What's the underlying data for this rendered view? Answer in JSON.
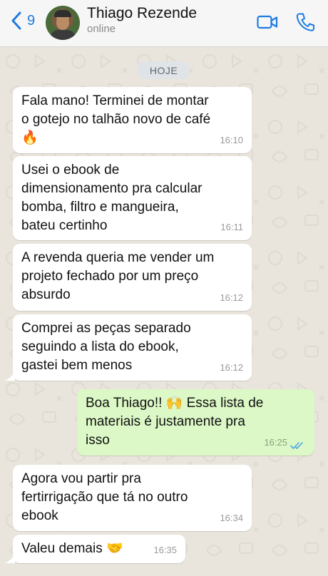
{
  "header": {
    "back_count": "9",
    "contact_name": "Thiago Rezende",
    "contact_status": "online",
    "icons": {
      "back": "chevron-left-icon",
      "video": "video-camera-icon",
      "call": "phone-icon"
    },
    "accent_color": "#1f7ae0"
  },
  "chat": {
    "date_label": "HOJE",
    "messages": [
      {
        "direction": "incoming",
        "lines": [
          "Fala mano! Terminei de montar",
          "o gotejo no talhão novo de café",
          "🔥"
        ],
        "time": "16:10"
      },
      {
        "direction": "incoming",
        "lines": [
          "Usei o ebook de",
          "dimensionamento pra calcular",
          "bomba, filtro e mangueira,",
          "bateu certinho"
        ],
        "time": "16:11"
      },
      {
        "direction": "incoming",
        "lines": [
          "A revenda queria me vender um",
          "projeto fechado por um preço",
          "absurdo"
        ],
        "time": "16:12"
      },
      {
        "direction": "incoming",
        "lines": [
          "Comprei as peças separado",
          "seguindo a lista do ebook,",
          "gastei bem menos"
        ],
        "time": "16:12"
      },
      {
        "direction": "outgoing",
        "lines": [
          "Boa Thiago!! 🙌  Essa lista de",
          "materiais é justamente pra",
          "isso"
        ],
        "time": "16:25",
        "status": "read"
      },
      {
        "direction": "incoming",
        "lines": [
          "Agora vou partir pra",
          "fertirrigação que tá no outro",
          "ebook"
        ],
        "time": "16:34"
      },
      {
        "direction": "incoming",
        "lines": [
          "Valeu demais 🤝"
        ],
        "time": "16:35"
      }
    ],
    "colors": {
      "incoming_bubble": "#ffffff",
      "outgoing_bubble": "#dcf8c6",
      "read_ticks": "#4fa3e3",
      "wallpaper": "#e9e4dc"
    }
  }
}
